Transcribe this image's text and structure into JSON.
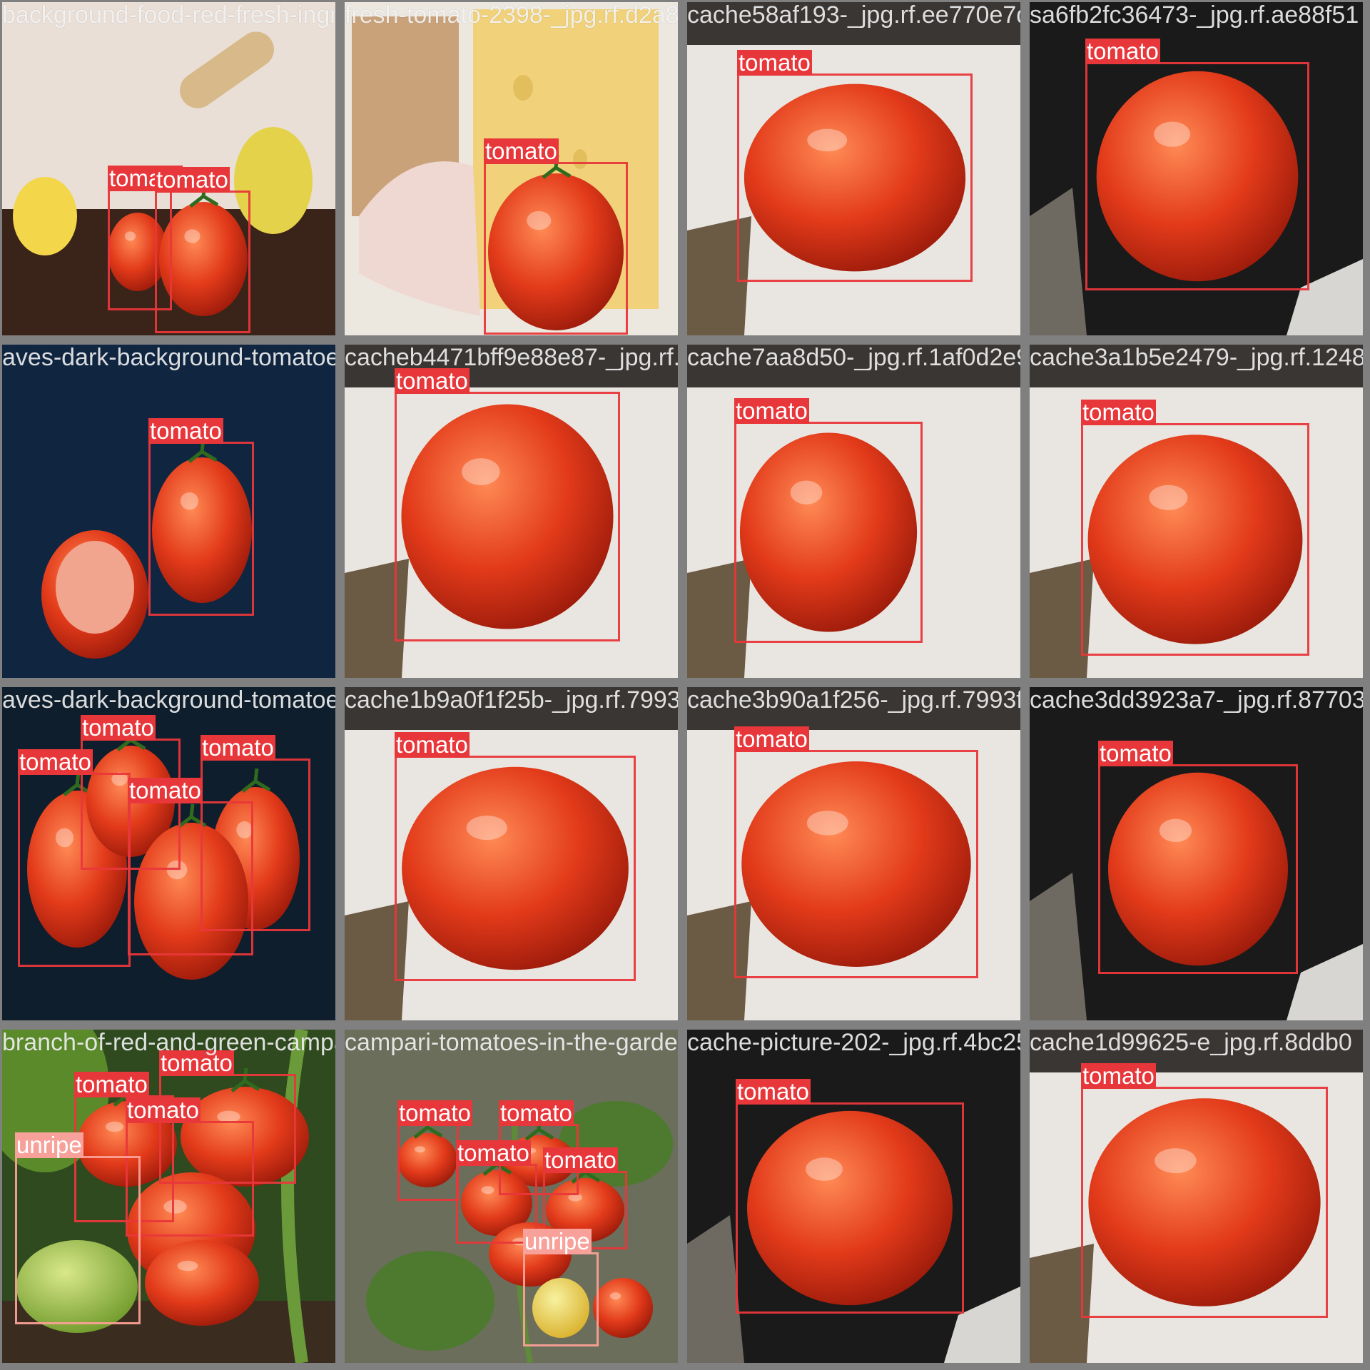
{
  "colors": {
    "tomato_box": "#e8373a",
    "unripe_box": "#f7a19a",
    "grid_gap": "#808080"
  },
  "tiles": [
    {
      "filename": "background-food-red-fresh-ingredient-ingredient-1-jpg.rf.62597",
      "scene": "table",
      "boxes": [
        {
          "label": "tomato"
        },
        {
          "label": "tomato"
        }
      ]
    },
    {
      "filename": "fresh-tomato-2398-_jpg.rf.d2a88b6b3f5a7c2bf19e4e80cf9d1c6e",
      "scene": "cheese",
      "boxes": [
        {
          "label": "tomato"
        }
      ]
    },
    {
      "filename": "cache58af193-_jpg.rf.ee770e7d2f1c1a23b",
      "scene": "box",
      "boxes": [
        {
          "label": "tomato"
        }
      ]
    },
    {
      "filename": "sa6fb2fc36473-_jpg.rf.ae88f51",
      "scene": "dark",
      "boxes": [
        {
          "label": "tomato"
        }
      ]
    },
    {
      "filename": "aves-dark-background-tomatoes-water-18-_jpg.rf.7121",
      "scene": "blue",
      "boxes": [
        {
          "label": "tomato"
        }
      ]
    },
    {
      "filename": "cacheb4471bff9e88e87-_jpg.rf.1af0d2e95061b52479",
      "scene": "box",
      "boxes": [
        {
          "label": "tomato"
        }
      ]
    },
    {
      "filename": "cache7aa8d50-_jpg.rf.1af0d2e95061b52479",
      "scene": "box",
      "boxes": [
        {
          "label": "tomato"
        }
      ]
    },
    {
      "filename": "cache3a1b5e2479-_jpg.rf.12482",
      "scene": "box",
      "boxes": [
        {
          "label": "tomato"
        }
      ]
    },
    {
      "filename": "aves-dark-background-tomatoes-water-137-_jpg.rf.7bbbb",
      "scene": "cluster",
      "boxes": [
        {
          "label": "tomato"
        },
        {
          "label": "tomato"
        },
        {
          "label": "tomato"
        },
        {
          "label": "tomato"
        }
      ]
    },
    {
      "filename": "cache1b9a0f1f25b-_jpg.rf.7993f3cfdf13d2a7",
      "scene": "box",
      "boxes": [
        {
          "label": "tomato"
        }
      ]
    },
    {
      "filename": "cache3b90a1f256-_jpg.rf.7993f3cf",
      "scene": "box",
      "boxes": [
        {
          "label": "tomato"
        }
      ]
    },
    {
      "filename": "cache3dd3923a7-_jpg.rf.87703",
      "scene": "dark",
      "boxes": [
        {
          "label": "tomato"
        }
      ]
    },
    {
      "filename": "branch-of-red-and-green-campari-tomatoes",
      "scene": "branch",
      "boxes": [
        {
          "label": "tomato"
        },
        {
          "label": "tomato"
        },
        {
          "label": "tomato"
        },
        {
          "label": "unripe"
        }
      ]
    },
    {
      "filename": "campari-tomatoes-in-the-garden-picture-2",
      "scene": "garden",
      "boxes": [
        {
          "label": "tomato"
        },
        {
          "label": "tomato"
        },
        {
          "label": "tomato"
        },
        {
          "label": "tomato"
        },
        {
          "label": "unripe"
        }
      ]
    },
    {
      "filename": "cache-picture-202-_jpg.rf.4bc2563",
      "scene": "dark",
      "boxes": [
        {
          "label": "tomato"
        }
      ]
    },
    {
      "filename": "cache1d99625-e_jpg.rf.8ddb0",
      "scene": "box",
      "boxes": [
        {
          "label": "tomato"
        }
      ]
    }
  ]
}
